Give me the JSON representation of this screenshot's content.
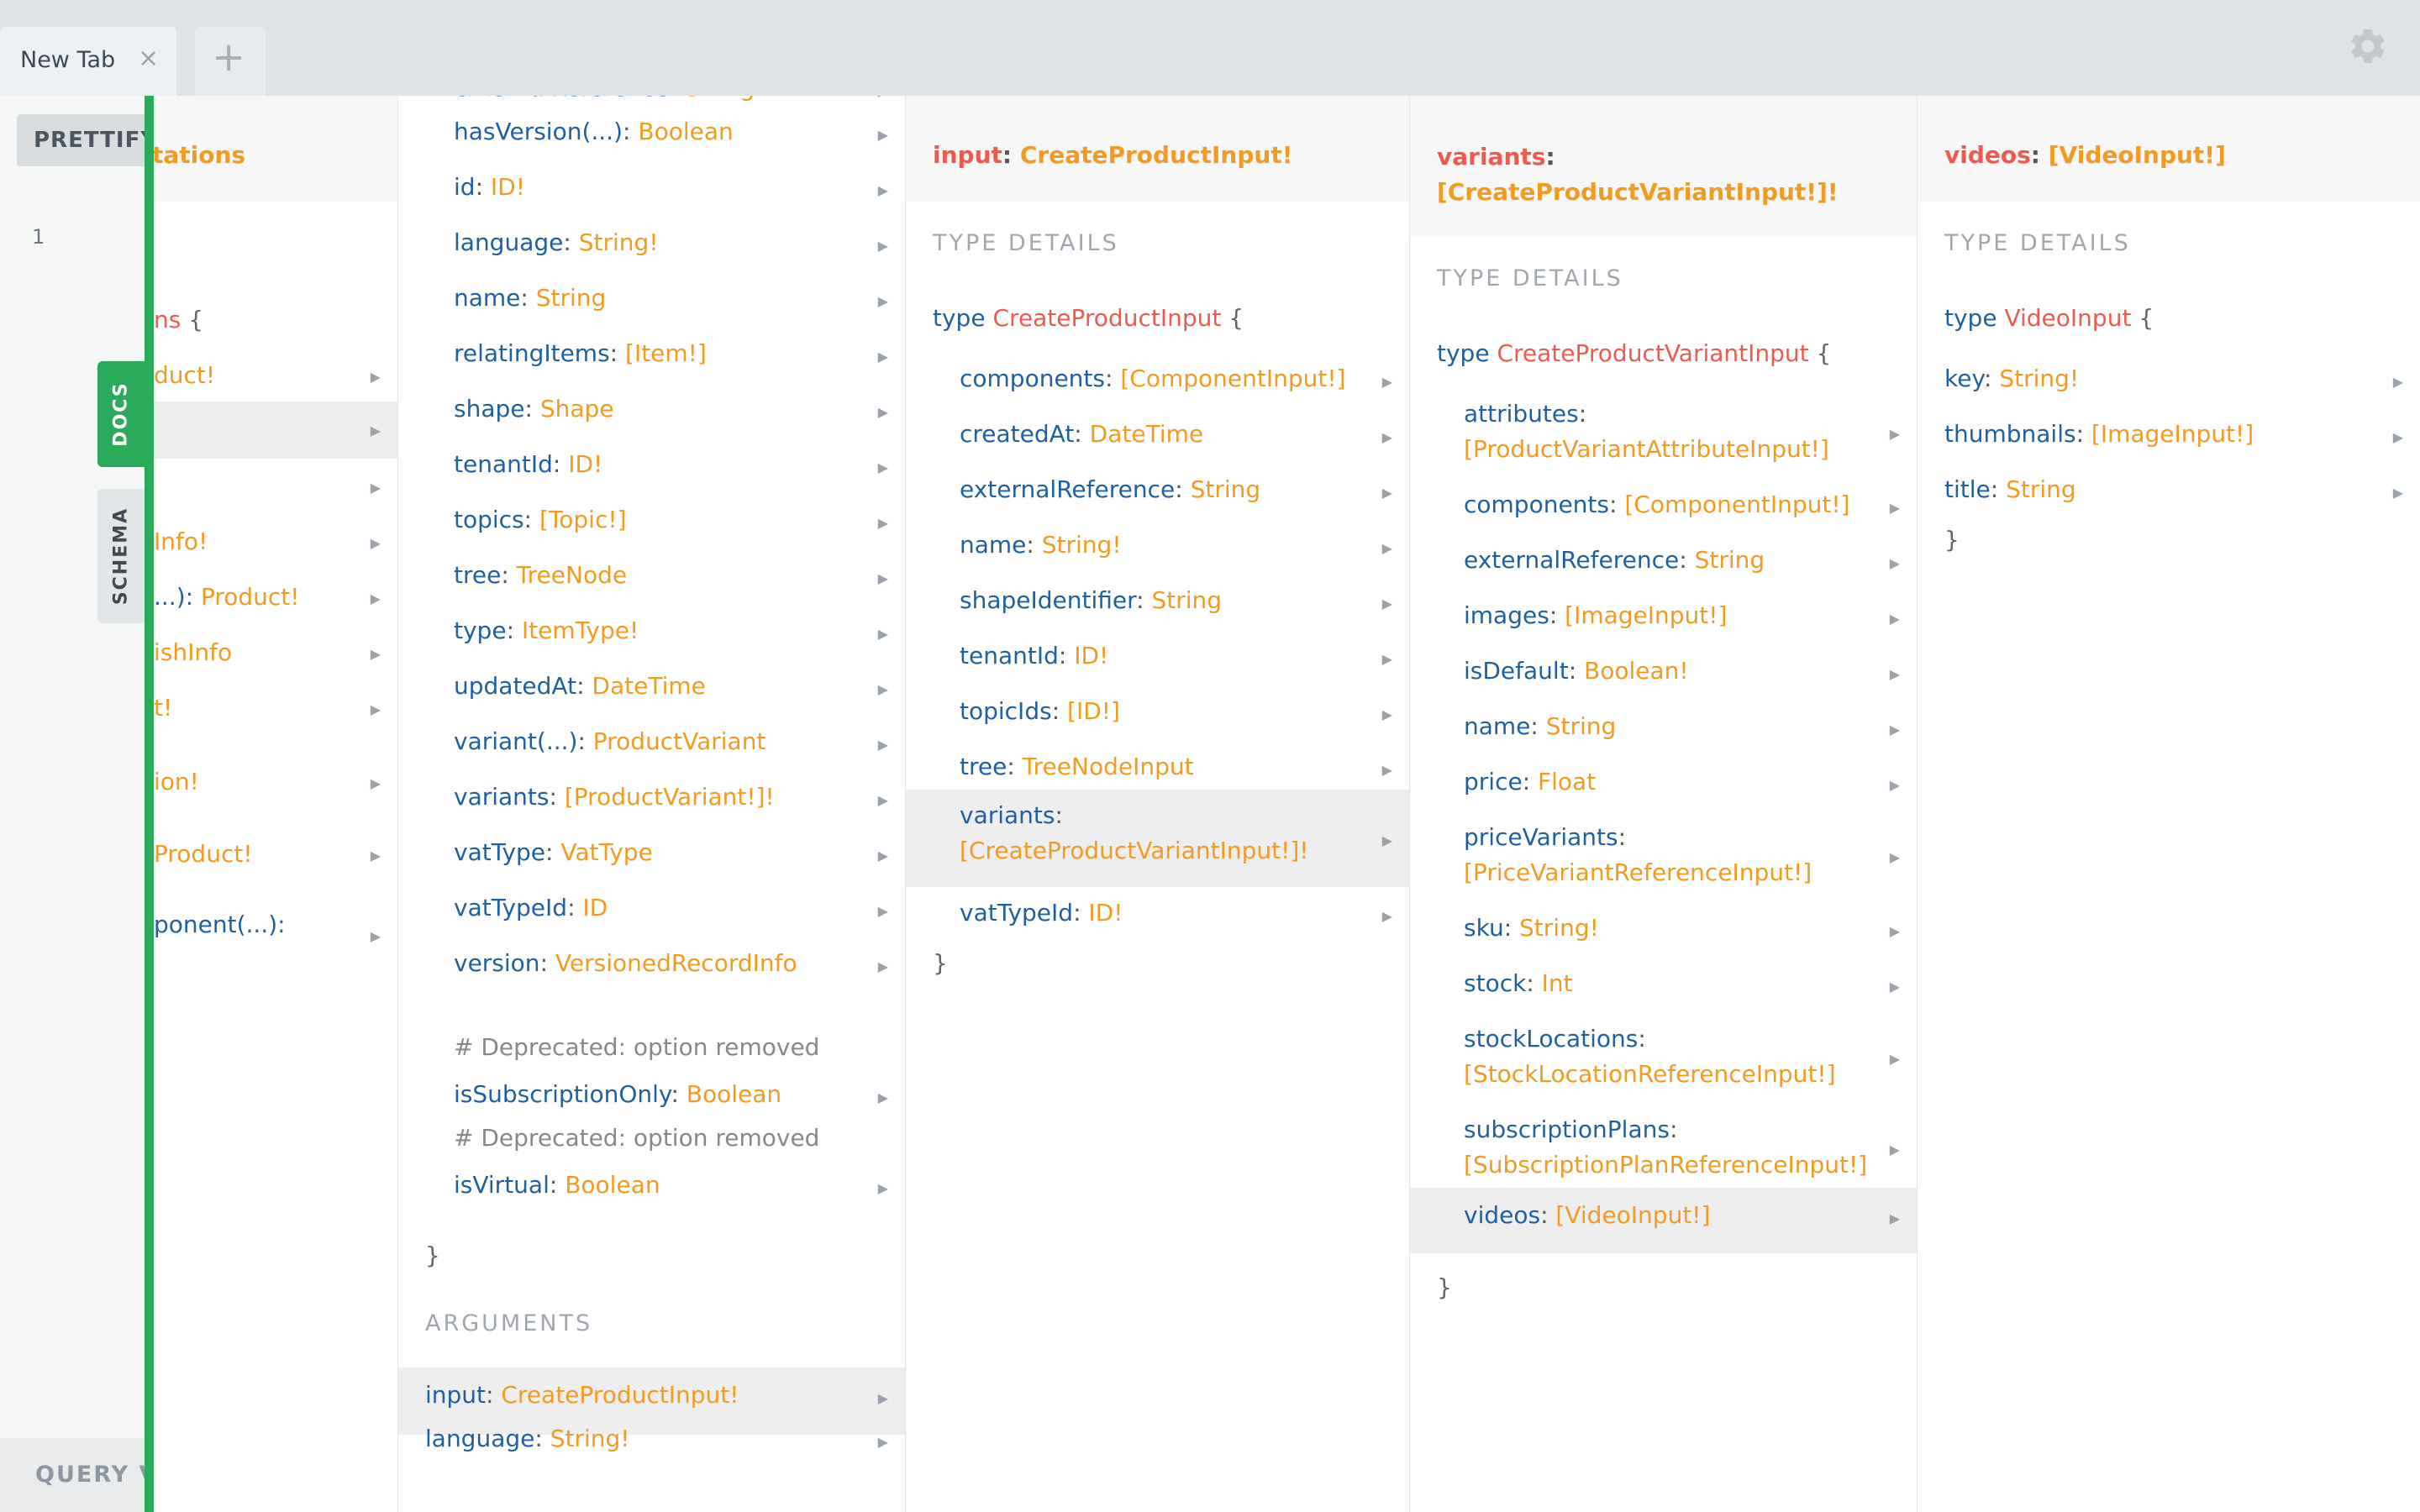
{
  "tabs": {
    "active_label": "New Tab",
    "close_glyph": "×",
    "add_glyph": "+"
  },
  "toolbar": {
    "prettify_label": "PRETTIFY",
    "settings_icon": "gear-icon"
  },
  "editor": {
    "line_number": "1",
    "query_variables_label": "QUERY VA"
  },
  "side_tabs": {
    "docs": "DOCS",
    "schema": "SCHEMA"
  },
  "colors": {
    "accent_green": "#2bab5a",
    "field": "#1f61a0",
    "type": "#f29b22",
    "type_name": "#ee5a4f"
  },
  "col0": {
    "header": "tations",
    "rows": [
      {
        "name": "ns",
        "type": "",
        "brace": "{"
      },
      {
        "name": "",
        "type": "duct!"
      },
      {
        "name": "",
        "type": ""
      },
      {
        "name": "",
        "type": ""
      },
      {
        "name": "",
        "type": "Info!"
      },
      {
        "name": "...):",
        "type": "Product!"
      },
      {
        "name": "",
        "type": "ishInfo"
      },
      {
        "name": "",
        "type": "t!"
      },
      {
        "name": "",
        "type": "ion!"
      },
      {
        "name": "",
        "type": "Product!"
      },
      {
        "name": "ponent(...):",
        "type": ""
      }
    ]
  },
  "col1": {
    "rows": [
      {
        "name": "externalReference",
        "type": "String"
      },
      {
        "name": "hasVersion(...)",
        "type": "Boolean"
      },
      {
        "name": "id",
        "type": "ID!"
      },
      {
        "name": "language",
        "type": "String!"
      },
      {
        "name": "name",
        "type": "String"
      },
      {
        "name": "relatingItems",
        "type": "[Item!]"
      },
      {
        "name": "shape",
        "type": "Shape"
      },
      {
        "name": "tenantId",
        "type": "ID!"
      },
      {
        "name": "topics",
        "type": "[Topic!]"
      },
      {
        "name": "tree",
        "type": "TreeNode"
      },
      {
        "name": "type",
        "type": "ItemType!"
      },
      {
        "name": "updatedAt",
        "type": "DateTime"
      },
      {
        "name": "variant(...)",
        "type": "ProductVariant"
      },
      {
        "name": "variants",
        "type": "[ProductVariant!]!"
      },
      {
        "name": "vatType",
        "type": "VatType"
      },
      {
        "name": "vatTypeId",
        "type": "ID"
      },
      {
        "name": "version",
        "type": "VersionedRecordInfo"
      }
    ],
    "deprecated": [
      {
        "comment": "# Deprecated: option removed",
        "name": "isSubscriptionOnly",
        "type": "Boolean"
      },
      {
        "comment": "# Deprecated: option removed",
        "name": "isVirtual",
        "type": "Boolean"
      }
    ],
    "close_brace": "}",
    "arguments_label": "ARGUMENTS",
    "arguments": [
      {
        "name": "input",
        "type": "CreateProductInput!"
      },
      {
        "name": "language",
        "type": "String!"
      }
    ]
  },
  "col2": {
    "header_name": "input",
    "header_type": "CreateProductInput!",
    "section": "TYPE DETAILS",
    "type_kw": "type",
    "type_name": "CreateProductInput",
    "open_brace": "{",
    "close_brace": "}",
    "fields": [
      {
        "name": "components",
        "type": "[ComponentInput!]"
      },
      {
        "name": "createdAt",
        "type": "DateTime"
      },
      {
        "name": "externalReference",
        "type": "String"
      },
      {
        "name": "name",
        "type": "String!"
      },
      {
        "name": "shapeIdentifier",
        "type": "String"
      },
      {
        "name": "tenantId",
        "type": "ID!"
      },
      {
        "name": "topicIds",
        "type": "[ID!]"
      },
      {
        "name": "tree",
        "type": "TreeNodeInput"
      },
      {
        "name": "variants",
        "type": "[CreateProductVariantInput!]!"
      },
      {
        "name": "vatTypeId",
        "type": "ID!"
      }
    ]
  },
  "col3": {
    "header_name": "variants",
    "header_type": "[CreateProductVariantInput!]!",
    "section": "TYPE DETAILS",
    "type_kw": "type",
    "type_name": "CreateProductVariantInput",
    "open_brace": "{",
    "close_brace": "}",
    "fields": [
      {
        "name": "attributes",
        "type": "[ProductVariantAttributeInput!]"
      },
      {
        "name": "components",
        "type": "[ComponentInput!]"
      },
      {
        "name": "externalReference",
        "type": "String"
      },
      {
        "name": "images",
        "type": "[ImageInput!]"
      },
      {
        "name": "isDefault",
        "type": "Boolean!"
      },
      {
        "name": "name",
        "type": "String"
      },
      {
        "name": "price",
        "type": "Float"
      },
      {
        "name": "priceVariants",
        "type": "[PriceVariantReferenceInput!]"
      },
      {
        "name": "sku",
        "type": "String!"
      },
      {
        "name": "stock",
        "type": "Int"
      },
      {
        "name": "stockLocations",
        "type": "[StockLocationReferenceInput!]"
      },
      {
        "name": "subscriptionPlans",
        "type": "[SubscriptionPlanReferenceInput!]"
      },
      {
        "name": "videos",
        "type": "[VideoInput!]"
      }
    ]
  },
  "col4": {
    "header_name": "videos",
    "header_type": "[VideoInput!]",
    "section": "TYPE DETAILS",
    "type_kw": "type",
    "type_name": "VideoInput",
    "open_brace": "{",
    "close_brace": "}",
    "fields": [
      {
        "name": "key",
        "type": "String!"
      },
      {
        "name": "thumbnails",
        "type": "[ImageInput!]"
      },
      {
        "name": "title",
        "type": "String"
      }
    ]
  }
}
